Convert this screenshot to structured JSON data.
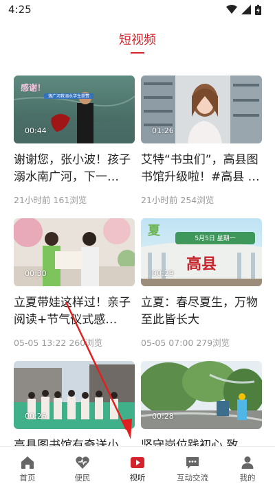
{
  "status_bar": {
    "time": "4:25"
  },
  "page": {
    "title": "短视频"
  },
  "videos": [
    {
      "duration": "00:44",
      "title": "谢谢您，张小波！孩子溺水南广河，下一…",
      "time": "21小时前",
      "views": "161浏览",
      "thumb_overlay": "感谢！",
      "thumb_subtitle": "落广河救溺水学生获赞"
    },
    {
      "duration": "01:26",
      "title": "艾特“书虫们”，高县图书馆升级啦！#高县 …",
      "time": "21小时前",
      "views": "254浏览"
    },
    {
      "duration": "00:30",
      "title": "立夏带娃这样过！亲子阅读+节气仪式感…",
      "time": "05-05 13:22",
      "views": "260浏览"
    },
    {
      "duration": "00:29",
      "title": "立夏：春尽夏生，万物至此皆长大",
      "time": "05-05 07:00",
      "views": "279浏览",
      "thumb_overlay": "高县",
      "thumb_banner": "5月5日 星期一",
      "thumb_corner": "夏"
    },
    {
      "duration": "00:26",
      "title": "高县图书馆有奇送小…",
      "time": "",
      "views": ""
    },
    {
      "duration": "00:28",
      "title": "坚守岗位践初心 致…",
      "time": "",
      "views": ""
    }
  ],
  "nav": [
    {
      "label": "首页",
      "icon": "home-icon"
    },
    {
      "label": "便民",
      "icon": "heart-icon"
    },
    {
      "label": "视听",
      "icon": "play-icon"
    },
    {
      "label": "互动交流",
      "icon": "chat-icon"
    },
    {
      "label": "我的",
      "icon": "person-icon"
    }
  ],
  "colors": {
    "accent": "#d3232b",
    "muted": "#999999",
    "annotation_arrow": "#e02020"
  }
}
